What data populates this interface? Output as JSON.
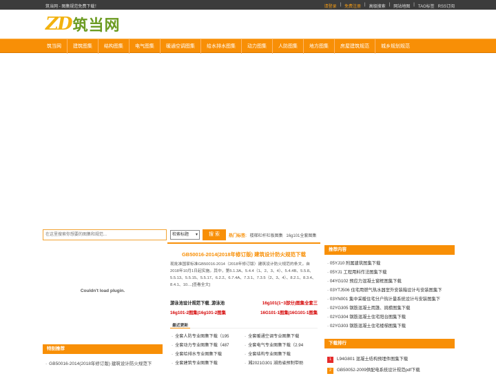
{
  "topbar": {
    "left": "筑当网 - 图集规范免费下载！",
    "login": "请登录",
    "register": "免费注册",
    "links": [
      "高级搜索",
      "网站地图",
      "TAG标签",
      "RSS订阅"
    ]
  },
  "logo": {
    "mark": "ZD",
    "text": "筑当网"
  },
  "nav": [
    "筑当网",
    "建筑图集",
    "结构图集",
    "电气图集",
    "暖通空调图集",
    "给水排水图集",
    "动力图集",
    "人防图集",
    "地方图集",
    "房屋建筑规范",
    "城乡规划规范"
  ],
  "search": {
    "placeholder": "在这里搜索你想要的图集和规范...",
    "select_value": "检索标题",
    "button": "搜 索",
    "hot_label": "热门标签:",
    "hot_tags": [
      "楼梯栏杆栏板图集",
      "16g101全套图集"
    ]
  },
  "plugin_msg": "Couldn't load plugin.",
  "special": {
    "title": "特别推荐",
    "items": [
      "GB50016-2014(2018年修订版) 建筑设计防火规范下"
    ]
  },
  "center": {
    "title": "GB50016-2014(2018年修订版) 建筑设计防火规范下载",
    "desc": "现批准国家标准GB50016-2014（2018年修订版）建筑设计防火规范的条文，自2018年10月1日起实施。其中，第5.1.3A、5.4.4（1、2、3、4）、5.4.4B、5.5.8、5.5.13、5.5.15、5.5.17、6.2.2、6.7.4A、7.3.1、7.3.5（2、3、4）、8.2.1、8.3.4、8.4.1、10....[查看全文]",
    "links": [
      {
        "a": "游泳池设计规范下载_游泳池",
        "b": "16g101(1~3部分)图集全套三"
      },
      {
        "a": "16g101-2图集|16g101-2图集",
        "b": "16G101-1图集|16G101-1图集"
      }
    ],
    "recent_label": "最近更新",
    "recent": [
      "全套人防专业图集下载（195",
      "全套暖通空调专业图集下载",
      "全套动力专业图集下载（487",
      "全套电气专业图集下载（2.94",
      "全套给排水专业图集下载",
      "全套结构专业图集下载",
      "全套建筑专业图集下载",
      "湘2021G301 湖南省预制带助"
    ]
  },
  "recommend": {
    "title": "推荐内容",
    "items": [
      "05YJ10 附属建筑图集下载",
      "05YJ1 工程用料作法图集下载",
      "04YG102 预应力混凝土窗框图集下载",
      "03YTJ506 住宅用燃气热水器室外安装箱设计与安装图集下",
      "03YN001 集中采暖住宅分户热计量系统设计与安装图集下",
      "02YG305 钢筋混凝土雨篷、挑檐图集下载",
      "02YG304 钢筋混凝土住宅阳台图集下载",
      "02YG303 钢筋混凝土住宅楼梯图集下载"
    ]
  },
  "ranking": {
    "title": "下载排行",
    "items": [
      {
        "num": "1",
        "text": "L94G801 混凝土结构预埋件图集下载",
        "color": "#e52b2b"
      },
      {
        "num": "2",
        "text": "GB50052-2009供配电系统设计规范pdf下载",
        "color": "#f88f06"
      }
    ]
  }
}
